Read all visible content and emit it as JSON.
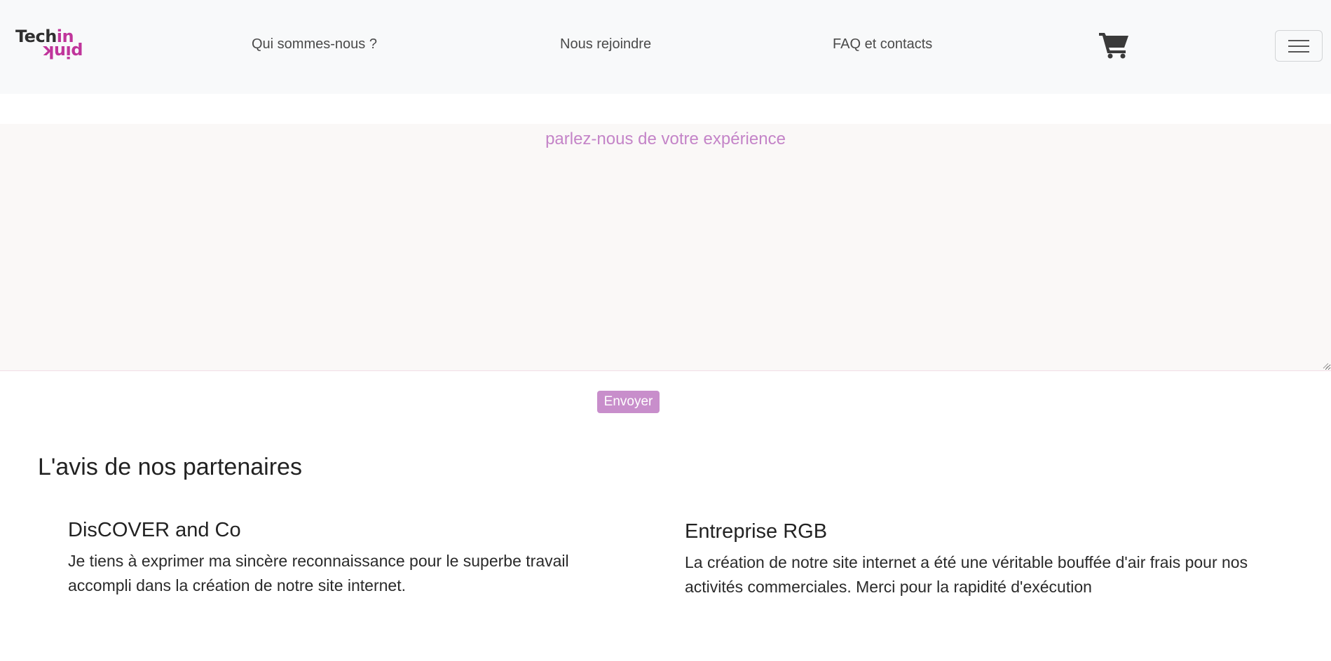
{
  "header": {
    "logo": {
      "text_top": "Tech",
      "text_accent": "in",
      "text_bottom": "pink"
    },
    "nav": [
      {
        "label": "Qui sommes-nous ?"
      },
      {
        "label": "Nous rejoindre"
      },
      {
        "label": "FAQ et contacts"
      }
    ],
    "cart_icon": "shopping-cart-icon",
    "menu_icon": "hamburger-menu-icon"
  },
  "feedback": {
    "placeholder": "parlez-nous de votre expérience",
    "value": "",
    "submit_label": "Envoyer"
  },
  "partners": {
    "title": "L'avis de nos partenaires",
    "reviews": [
      {
        "name": "DisCOVER and Co",
        "text": "Je tiens à exprimer ma sincère reconnaissance pour le superbe travail accompli dans la création de notre site internet."
      },
      {
        "name": "Entreprise RGB",
        "text": "La création de notre site internet a été une véritable bouffée d'air frais pour nos activités commerciales. Merci pour la rapidité d'exécution"
      }
    ]
  },
  "colors": {
    "navbar_bg": "#f8f9fa",
    "brand_pink": "#c0359b",
    "placeholder": "#c484c8",
    "button_bg": "#c88ecb",
    "textarea_bg": "#faf8f7"
  }
}
